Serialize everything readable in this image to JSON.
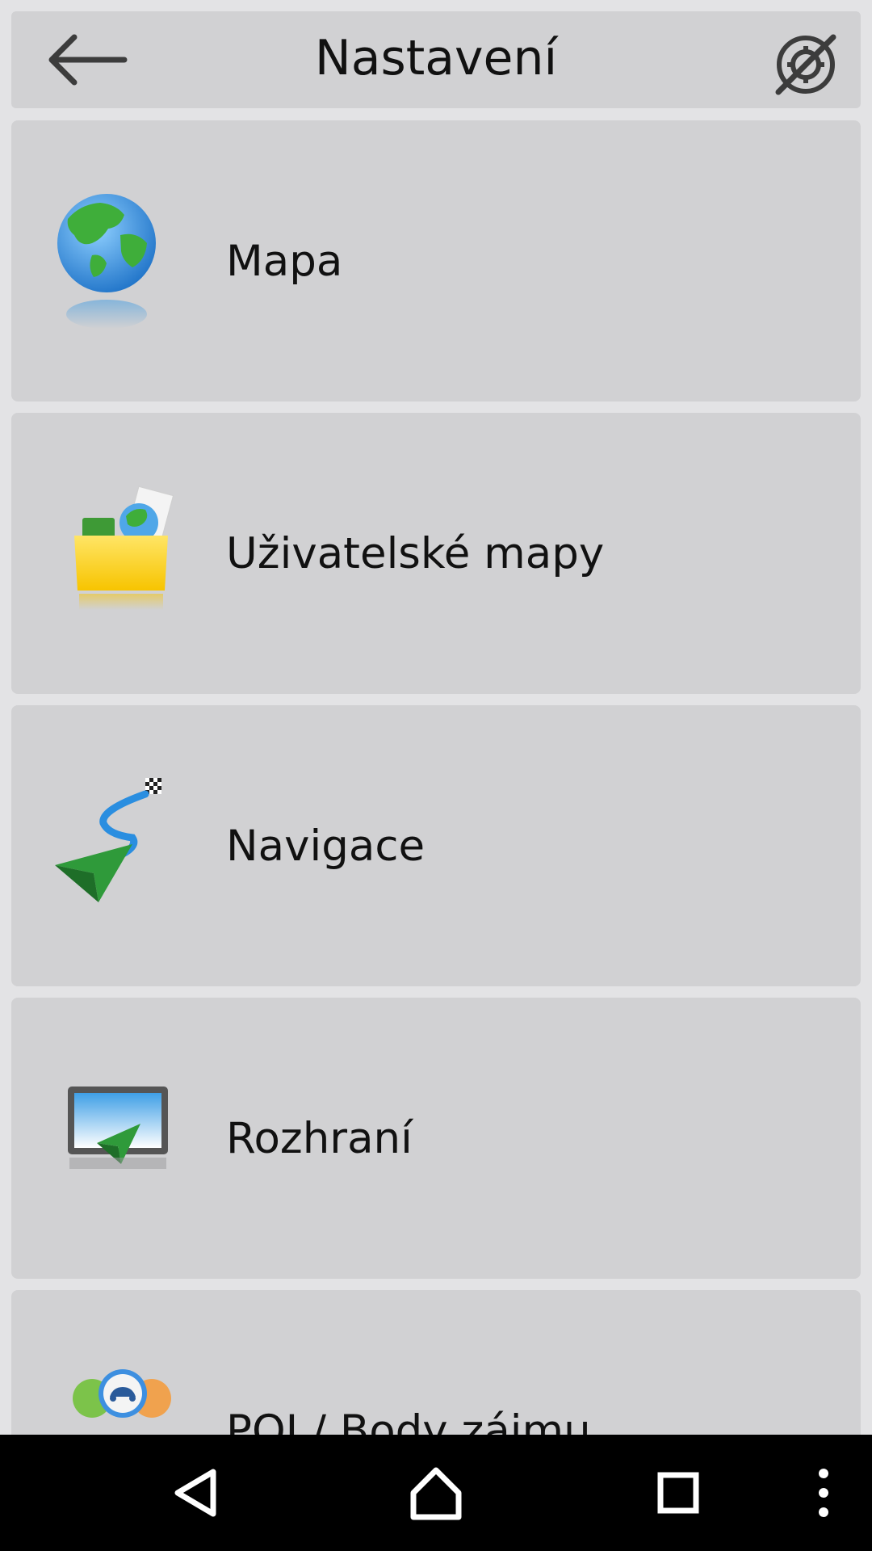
{
  "header": {
    "title": "Nastavení",
    "back_icon": "arrow-left-icon",
    "gps_icon": "gps-off-icon"
  },
  "menu": {
    "items": [
      {
        "label": "Mapa",
        "icon": "globe-icon"
      },
      {
        "label": "Uživatelské mapy",
        "icon": "folder-globe-icon"
      },
      {
        "label": "Navigace",
        "icon": "navigation-route-icon"
      },
      {
        "label": "Rozhraní",
        "icon": "screen-display-icon"
      },
      {
        "label": "POI / Body zájmu",
        "icon": "poi-pins-icon"
      }
    ]
  },
  "system_nav": {
    "back_icon": "triangle-back-icon",
    "home_icon": "home-icon",
    "recents_icon": "square-recents-icon",
    "menu_icon": "overflow-menu-icon"
  }
}
